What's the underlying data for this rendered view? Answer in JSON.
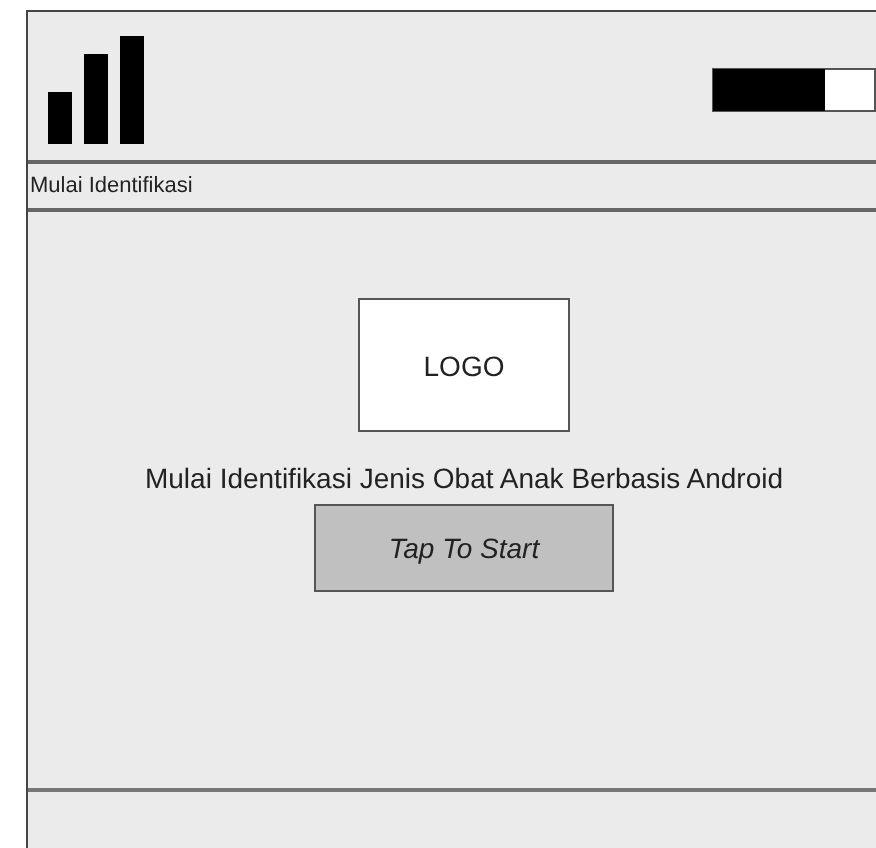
{
  "header": {
    "title": "Mulai Identifikasi"
  },
  "logo": {
    "label": "LOGO"
  },
  "subtitle": "Mulai Identifikasi Jenis Obat Anak Berbasis Android",
  "start_button": {
    "label": "Tap To Start"
  }
}
